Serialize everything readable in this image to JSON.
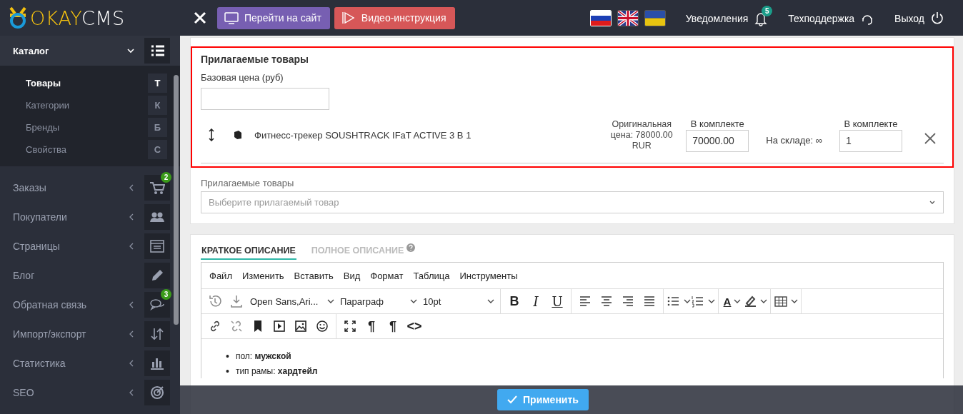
{
  "header": {
    "logo": {
      "part_1": "OKAY",
      "part_2": "CMS"
    },
    "buttons": [
      {
        "label": "Перейти на сайт",
        "kind": "site"
      },
      {
        "label": "Видео-инструкция",
        "kind": "video"
      }
    ],
    "languages": [
      {
        "selected": true
      },
      {
        "selected": false
      },
      {
        "selected": false
      }
    ],
    "notifications": {
      "label": "Уведомления",
      "badge": "5"
    },
    "support": {
      "label": "Техподдержка"
    },
    "logout": {
      "label": "Выход"
    }
  },
  "sidebar": {
    "items": [
      {
        "label": "Каталог",
        "kind": "group",
        "expanded": true,
        "children": [
          {
            "label": "Товары",
            "letter": "Т",
            "selected": true
          },
          {
            "label": "Категории",
            "letter": "К",
            "selected": false
          },
          {
            "label": "Бренды",
            "letter": "Б",
            "selected": false
          },
          {
            "label": "Свойства",
            "letter": "С",
            "selected": false
          }
        ]
      },
      {
        "label": "Заказы",
        "kind": "group",
        "expanded": false,
        "badge": "2"
      },
      {
        "label": "Покупатели",
        "kind": "group",
        "expanded": false
      },
      {
        "label": "Страницы",
        "kind": "group",
        "expanded": false
      },
      {
        "label": "Блог",
        "kind": "link"
      },
      {
        "label": "Обратная связь",
        "kind": "group",
        "expanded": false,
        "badge": "3"
      },
      {
        "label": "Импорт/экспорт",
        "kind": "group",
        "expanded": false
      },
      {
        "label": "Статистика",
        "kind": "group",
        "expanded": false
      },
      {
        "label": "SEO",
        "kind": "group",
        "expanded": false
      }
    ]
  },
  "related_products": {
    "highlighted": true,
    "title": "Прилагаемые товары",
    "base_price": {
      "label": "Базовая цена (руб)"
    },
    "items": [
      {
        "name": "Фитнесс-трекер SOUSHTRACK IFaT ACTIVE 3 В 1",
        "original_price": "Оригинальная цена: 78000.00 RUR",
        "price_label": "В комплекте",
        "price": "70000.00",
        "stock": "На складе: ∞",
        "amount_label": "В комплекте",
        "amount": "1"
      }
    ],
    "select": {
      "label": "Прилагаемые товары",
      "placeholder": "Выберите прилагаемый товар"
    }
  },
  "editor": {
    "tabs": [
      {
        "label": "КРАТКОЕ ОПИСАНИЕ",
        "selected": true
      },
      {
        "label": "ПОЛНОЕ ОПИСАНИЕ",
        "selected": false
      }
    ],
    "menu": [
      "Файл",
      "Изменить",
      "Вставить",
      "Вид",
      "Формат",
      "Таблица",
      "Инструменты"
    ],
    "toolbar": {
      "font": "Open Sans,Ari...",
      "block": "Параграф",
      "size": "10pt",
      "bold": "B",
      "italic": "I",
      "underline": "U",
      "text_color": "A",
      "show_blocks": "¶",
      "invisibles": "¶",
      "code": "<>"
    },
    "content": [
      {
        "marker": "•",
        "text": "пол: **мужской**"
      },
      {
        "marker": "•",
        "text": "тип рамы: **хардтейл**"
      }
    ]
  },
  "apply_button": {
    "label": "Применить"
  }
}
